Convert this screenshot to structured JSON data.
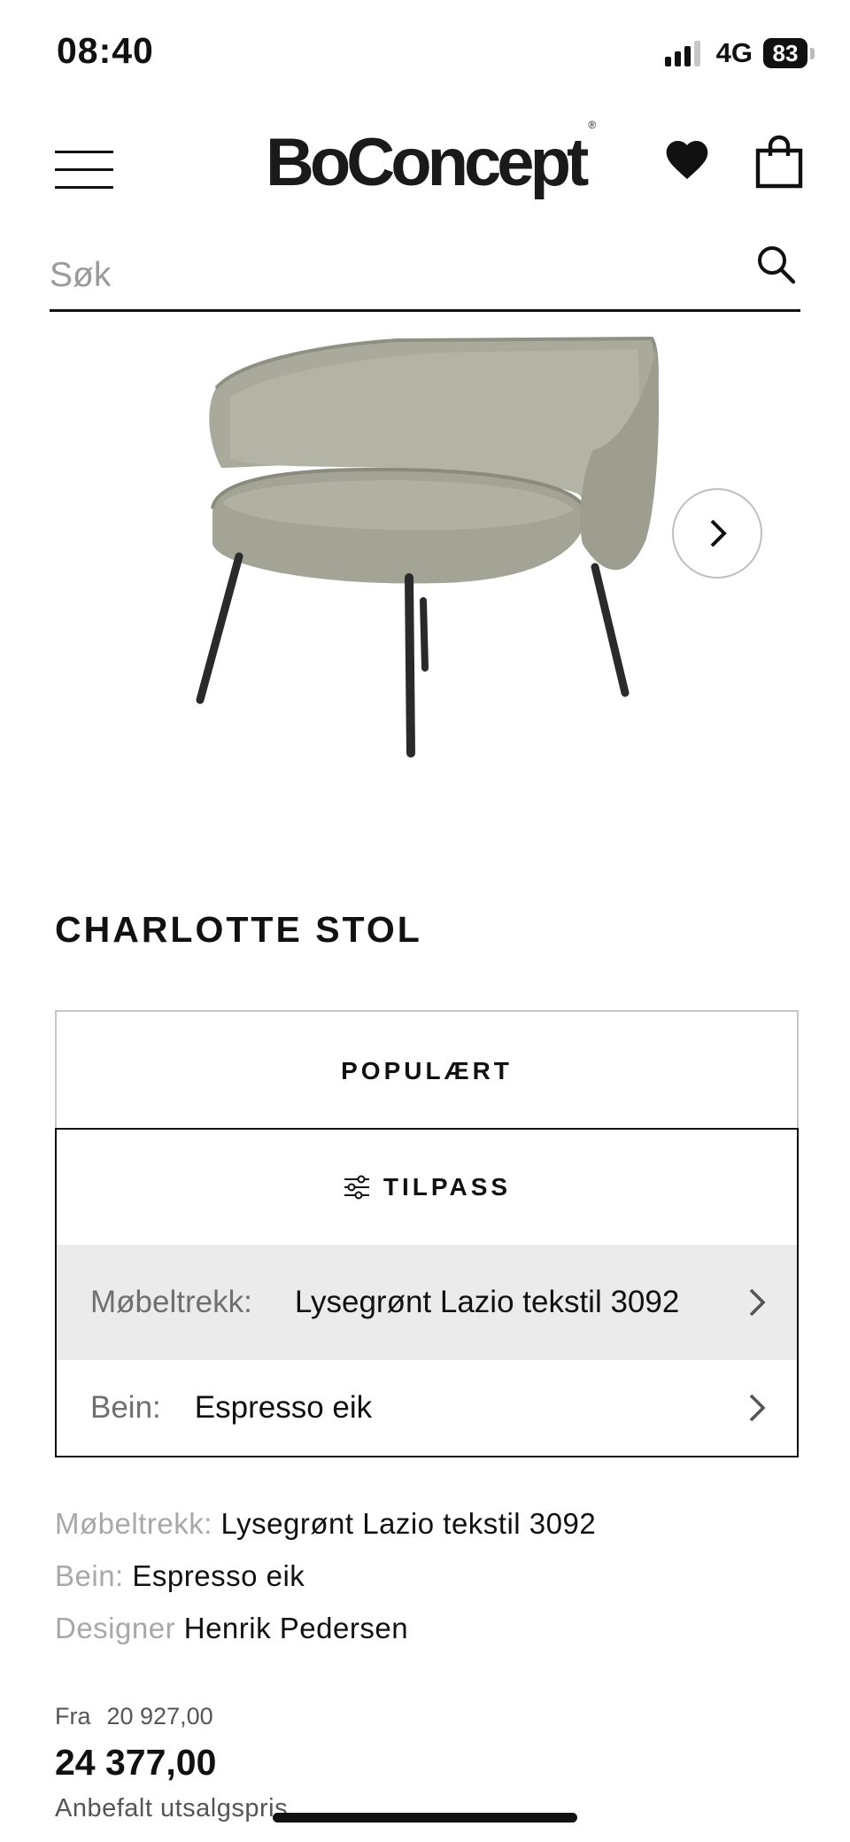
{
  "status_bar": {
    "time": "08:40",
    "network": "4G",
    "battery": "83",
    "signal_bars": 4,
    "signal_active_bars": 3
  },
  "header": {
    "logo": "BoConcept",
    "logo_mark": "®",
    "icons": [
      "menu-icon",
      "heart-icon",
      "shopping-bag-icon"
    ]
  },
  "search": {
    "placeholder": "Søk",
    "icon": "search-icon"
  },
  "product": {
    "title": "CHARLOTTE STOL",
    "image_next_icon": "chevron-right-icon"
  },
  "tabs": {
    "popular_label": "POPULÆRT",
    "customize_label": "TILPASS",
    "customize_icon": "sliders-icon"
  },
  "options": {
    "upholstery_label": "Møbeltrekk:",
    "upholstery_value": "Lysegrønt Lazio tekstil 3092",
    "legs_label": "Bein:",
    "legs_value": "Espresso eik"
  },
  "specs": {
    "upholstery_label": "Møbeltrekk:",
    "upholstery_value": "Lysegrønt Lazio tekstil 3092",
    "legs_label": "Bein:",
    "legs_value": "Espresso eik",
    "designer_label": "Designer",
    "designer_value": "Henrik Pedersen"
  },
  "price": {
    "from_label": "Fra",
    "from_value": "20 927,00",
    "current": "24 377,00",
    "note": "Anbefalt utsalgspris"
  },
  "colors": {
    "text": "#111111",
    "muted": "#a8a8a8",
    "selected_row": "#ebebeb",
    "chair_fabric": "#a9aa9b",
    "chair_legs": "#2a2a2a"
  }
}
